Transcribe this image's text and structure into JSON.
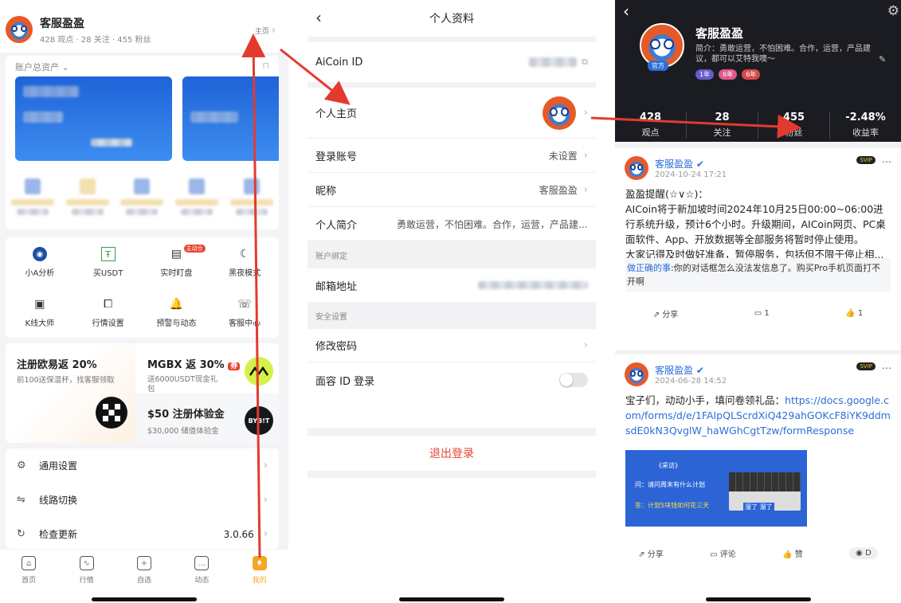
{
  "p1": {
    "user_name": "客服盈盈",
    "stats": "428 观点 · 28 关注 · 455 粉丝",
    "home_link": "主页",
    "asset_label": "账户总资产",
    "grid": [
      {
        "label": "小A分析",
        "icon": "ai-analysis-icon",
        "glyph": "◉",
        "badge": ""
      },
      {
        "label": "买USDT",
        "icon": "usdt-icon",
        "glyph": "Ŧ",
        "badge": ""
      },
      {
        "label": "实时盯盘",
        "icon": "monitor-icon",
        "glyph": "▤",
        "badge": "主动仓"
      },
      {
        "label": "黑夜模式",
        "icon": "moon-icon",
        "glyph": "☾",
        "badge": ""
      },
      {
        "label": "K线大师",
        "icon": "kline-icon",
        "glyph": "▣",
        "badge": ""
      },
      {
        "label": "行情设置",
        "icon": "chart-settings-icon",
        "glyph": "⧠",
        "badge": ""
      },
      {
        "label": "预警与动态",
        "icon": "bell-icon",
        "glyph": "🔔",
        "badge": ""
      },
      {
        "label": "客服中心",
        "icon": "service-icon",
        "glyph": "☏",
        "badge": ""
      }
    ],
    "promo1_title": "注册欧易返 20%",
    "promo1_sub": "前100送保温杯，找客服领取",
    "promo2_title": "MGBX 返 30%",
    "promo2_badge": "券",
    "promo2_sub": "送6000USDT现金礼包",
    "promo3_title": "$50 注册体验金",
    "promo3_sub": "$30,000 储值体验金",
    "bybit": "BYB!T",
    "settings": [
      {
        "label": "通用设置",
        "value": "",
        "icon": "gear-icon",
        "glyph": "⚙"
      },
      {
        "label": "线路切换",
        "value": "",
        "icon": "route-switch-icon",
        "glyph": "⇋"
      },
      {
        "label": "检查更新",
        "value": "3.0.66",
        "icon": "update-icon",
        "glyph": "↻"
      }
    ],
    "tabs": [
      {
        "label": "首页",
        "icon": "home-icon",
        "glyph": "⌂"
      },
      {
        "label": "行情",
        "icon": "market-icon",
        "glyph": "∿"
      },
      {
        "label": "自选",
        "icon": "watchlist-icon",
        "glyph": "+"
      },
      {
        "label": "动态",
        "icon": "feed-icon",
        "glyph": "…"
      },
      {
        "label": "我的",
        "icon": "profile-icon",
        "glyph": "♦"
      }
    ],
    "active_tab_color": "#f5a623"
  },
  "p2": {
    "title": "个人资料",
    "rows1": [
      {
        "label": "AiCoin ID",
        "value": ""
      }
    ],
    "homepage_label": "个人主页",
    "rows2": [
      {
        "label": "登录账号",
        "value": "未设置"
      },
      {
        "label": "昵称",
        "value": "客服盈盈"
      },
      {
        "label": "个人简介",
        "value": "勇敢运营，不怕困难。合作，运营，产品建..."
      }
    ],
    "section_bind": "账户绑定",
    "email_label": "邮箱地址",
    "section_security": "安全设置",
    "change_password": "修改密码",
    "face_id": "面容 ID 登录",
    "logout": "退出登录"
  },
  "p3": {
    "name": "客服盈盈",
    "bio": "简介：勇敢运营，不怕困难。合作，运营，产品建议，都可以艾特我噢～",
    "official": "官方",
    "badges": [
      "1年",
      "6年",
      "6年"
    ],
    "stats": [
      {
        "value": "428",
        "label": "观点"
      },
      {
        "value": "28",
        "label": "关注"
      },
      {
        "value": "455",
        "label": "粉丝"
      },
      {
        "value": "-2.48%",
        "label": "收益率"
      }
    ],
    "posts": [
      {
        "name": "客服盈盈",
        "time": "2024-10-24 17:21",
        "svip": "SVIP",
        "text": "盈盈提醒(☆∨☆)：\nAICoin将于新加坡时间2024年10月25日00:00~06:00进行系统升级，预计6个小时。升级期间，AICoin网页、PC桌面软件、App、开放数据等全部服务将暂时停止使用。\n大家记得及时做好准备，暂停服务，包括但不限于停止相...",
        "quote_name": "做正确的事",
        "quote_text": ":你的对话框怎么没法发信息了。购买Pro手机页面打不开啊",
        "share": "分享",
        "comments": "1",
        "likes": "1"
      },
      {
        "name": "客服盈盈",
        "time": "2024-06-28 14:52",
        "svip": "SVIP",
        "text": "宝子们，动动小手，填问卷领礼品：",
        "link": "https://docs.google.com/forms/d/e/1FAIpQLScrdXiQ429ahGOKcF8iYK9ddmsdE0kN3QvglW_haWGhCgtTzw/formResponse",
        "img_title": "《采访》",
        "img_q": "问：请问周末有什么计划",
        "img_a": "答：计划5块钱如何花三天",
        "img_tag": "溜了 溜了",
        "share": "分享",
        "comment": "评论",
        "like": "赞",
        "views": "D"
      }
    ]
  }
}
